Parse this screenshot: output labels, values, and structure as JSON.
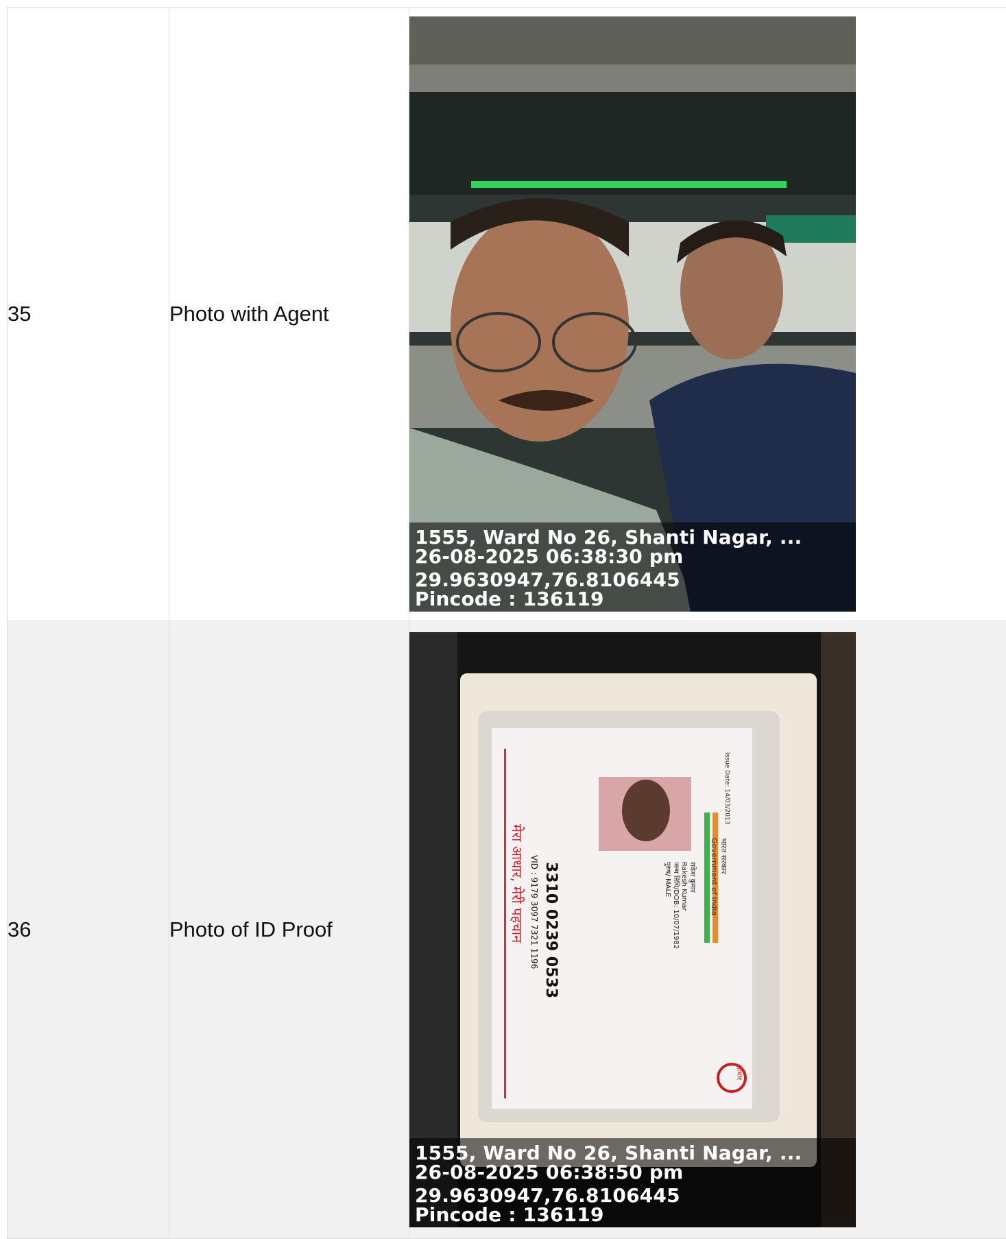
{
  "rows": [
    {
      "number": "35",
      "label": "Photo with Agent",
      "photo": {
        "stamp_address": "1555, Ward No 26, Shanti Nagar, ...",
        "stamp_datetime": "26-08-2025 06:38:30 pm",
        "stamp_coords": "29.9630947,76.8106445",
        "stamp_pincode": "Pincode : 136119"
      }
    },
    {
      "number": "36",
      "label": "Photo of ID Proof",
      "photo": {
        "stamp_address": "1555, Ward No 26, Shanti Nagar, ...",
        "stamp_datetime": "26-08-2025 06:38:50 pm",
        "stamp_coords": "29.9630947,76.8106445",
        "stamp_pincode": "Pincode : 136119"
      },
      "id_card": {
        "issue_date": "Issue Date: 14/03/2013",
        "gov_hindi": "भारत सरकार",
        "gov_english": "Government of India",
        "name_hindi": "राकेश कुमार",
        "name_english": "Rakesh Kumar",
        "dob": "जन्म तिथि/DOB: 10/07/1982",
        "gender": "पुरुष/ MALE",
        "number": "3310 0239 0533",
        "vid": "VID : 9179 3097 7321 1196",
        "slogan": "मेरा आधार, मेरी पहचान",
        "logo_text": "आधार"
      }
    }
  ]
}
